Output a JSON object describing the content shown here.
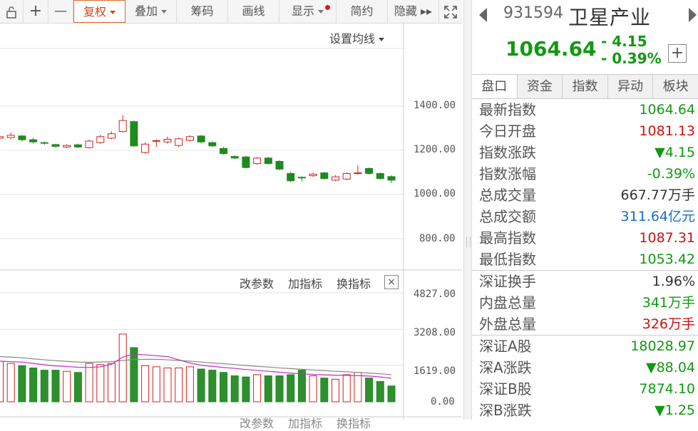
{
  "toolbar": {
    "items": [
      {
        "label": ""
      },
      {
        "label": "+"
      },
      {
        "label": "—"
      },
      {
        "label": "复权"
      },
      {
        "label": "叠加"
      },
      {
        "label": "筹码"
      },
      {
        "label": "画线"
      },
      {
        "label": "显示"
      },
      {
        "label": "简约"
      },
      {
        "label": "隐藏 ▸▸"
      },
      {
        "label": ""
      }
    ]
  },
  "kchart": {
    "ma_label": "设置均线",
    "price_ticks": [
      "1400.00",
      "1200.00",
      "1000.00",
      "800.00"
    ],
    "volume_ticks": [
      "4827.00",
      "3208.00",
      "1619.00",
      "0.00"
    ],
    "indicator_actions": [
      "改参数",
      "加指标",
      "换指标"
    ],
    "bottom_actions": [
      "改参数",
      "加指标",
      "换指标"
    ],
    "close_label": "×"
  },
  "chart_data": {
    "type": "candlestick",
    "price_axis": [
      800,
      1400
    ],
    "volume_axis": [
      0,
      4827
    ],
    "candles": [
      {
        "o": 1255,
        "c": 1262,
        "h": 1270,
        "l": 1245
      },
      {
        "o": 1258,
        "c": 1268,
        "h": 1280,
        "l": 1250
      },
      {
        "o": 1265,
        "c": 1248,
        "h": 1270,
        "l": 1240
      },
      {
        "o": 1248,
        "c": 1238,
        "h": 1258,
        "l": 1230
      },
      {
        "o": 1235,
        "c": 1232,
        "h": 1240,
        "l": 1225
      },
      {
        "o": 1226,
        "c": 1218,
        "h": 1230,
        "l": 1212
      },
      {
        "o": 1215,
        "c": 1222,
        "h": 1228,
        "l": 1210
      },
      {
        "o": 1225,
        "c": 1215,
        "h": 1230,
        "l": 1210
      },
      {
        "o": 1212,
        "c": 1242,
        "h": 1248,
        "l": 1208
      },
      {
        "o": 1235,
        "c": 1262,
        "h": 1270,
        "l": 1230
      },
      {
        "o": 1255,
        "c": 1275,
        "h": 1285,
        "l": 1250
      },
      {
        "o": 1285,
        "c": 1335,
        "h": 1360,
        "l": 1280
      },
      {
        "o": 1330,
        "c": 1220,
        "h": 1335,
        "l": 1215
      },
      {
        "o": 1190,
        "c": 1228,
        "h": 1236,
        "l": 1185
      },
      {
        "o": 1242,
        "c": 1244,
        "h": 1250,
        "l": 1215
      },
      {
        "o": 1238,
        "c": 1250,
        "h": 1262,
        "l": 1230
      },
      {
        "o": 1222,
        "c": 1252,
        "h": 1258,
        "l": 1215
      },
      {
        "o": 1245,
        "c": 1262,
        "h": 1268,
        "l": 1240
      },
      {
        "o": 1265,
        "c": 1238,
        "h": 1270,
        "l": 1232
      },
      {
        "o": 1235,
        "c": 1220,
        "h": 1240,
        "l": 1215
      },
      {
        "o": 1208,
        "c": 1185,
        "h": 1215,
        "l": 1180
      },
      {
        "o": 1172,
        "c": 1165,
        "h": 1178,
        "l": 1160
      },
      {
        "o": 1170,
        "c": 1122,
        "h": 1175,
        "l": 1118
      },
      {
        "o": 1140,
        "c": 1165,
        "h": 1170,
        "l": 1135
      },
      {
        "o": 1165,
        "c": 1140,
        "h": 1170,
        "l": 1135
      },
      {
        "o": 1150,
        "c": 1115,
        "h": 1155,
        "l": 1110
      },
      {
        "o": 1095,
        "c": 1062,
        "h": 1105,
        "l": 1055
      },
      {
        "o": 1078,
        "c": 1075,
        "h": 1082,
        "l": 1058
      },
      {
        "o": 1085,
        "c": 1092,
        "h": 1098,
        "l": 1080
      },
      {
        "o": 1098,
        "c": 1072,
        "h": 1102,
        "l": 1068
      },
      {
        "o": 1065,
        "c": 1080,
        "h": 1088,
        "l": 1060
      },
      {
        "o": 1070,
        "c": 1095,
        "h": 1100,
        "l": 1065
      },
      {
        "o": 1095,
        "c": 1098,
        "h": 1132,
        "l": 1090
      },
      {
        "o": 1118,
        "c": 1095,
        "h": 1122,
        "l": 1090
      },
      {
        "o": 1095,
        "c": 1072,
        "h": 1100,
        "l": 1068
      },
      {
        "o": 1081,
        "c": 1065,
        "h": 1087,
        "l": 1053
      }
    ],
    "volumes": [
      1800,
      1700,
      1600,
      1500,
      1400,
      1400,
      1350,
      1300,
      1700,
      1650,
      1700,
      3000,
      2400,
      1600,
      1550,
      1500,
      1500,
      1550,
      1450,
      1400,
      1300,
      1150,
      1100,
      1200,
      1150,
      1150,
      1200,
      1400,
      1150,
      1050,
      1000,
      1200,
      1300,
      1050,
      900,
      700
    ],
    "ma_volume_purple": [
      1800,
      1780,
      1760,
      1700,
      1640,
      1590,
      1560,
      1530,
      1520,
      1550,
      1660,
      1980,
      2120,
      2080,
      2040,
      2000,
      1860,
      1720,
      1620,
      1570,
      1520,
      1480,
      1430,
      1390,
      1350,
      1310,
      1270,
      1240,
      1210,
      1190,
      1180,
      1170,
      1160,
      1140,
      1100,
      1040
    ],
    "ma_volume_gray": [
      2000,
      1980,
      1950,
      1900,
      1860,
      1820,
      1790,
      1760,
      1750,
      1760,
      1780,
      1830,
      1870,
      1880,
      1880,
      1860,
      1830,
      1800,
      1760,
      1720,
      1690,
      1650,
      1610,
      1570,
      1540,
      1500,
      1470,
      1440,
      1410,
      1380,
      1350,
      1330,
      1300,
      1270,
      1240,
      1200
    ]
  },
  "quote": {
    "code": "931594",
    "name": "卫星产业",
    "price": "1064.64",
    "change": "- 4.15",
    "change_pct": "- 0.39%",
    "plus_label": "+"
  },
  "tabs": [
    "盘口",
    "资金",
    "指数",
    "异动",
    "板块"
  ],
  "rows_group1": [
    {
      "label": "最新指数",
      "value": "1064.64",
      "color": "#119911"
    },
    {
      "label": "今日开盘",
      "value": "1081.13",
      "color": "#cc1111"
    },
    {
      "label": "指数涨跌",
      "value": "▼4.15",
      "color": "#119911"
    },
    {
      "label": "指数涨幅",
      "value": "-0.39%",
      "color": "#119911"
    },
    {
      "label": "总成交量",
      "value": "667.77万手",
      "color": "#333333"
    },
    {
      "label": "总成交额",
      "value": "311.64亿元",
      "color": "#1a6ec8"
    },
    {
      "label": "最高指数",
      "value": "1087.31",
      "color": "#cc1111"
    },
    {
      "label": "最低指数",
      "value": "1053.42",
      "color": "#119911"
    }
  ],
  "rows_group2": [
    {
      "label": "深证换手",
      "value": "1.96%",
      "color": "#333333"
    },
    {
      "label": "内盘总量",
      "value": "341万手",
      "color": "#119911"
    },
    {
      "label": "外盘总量",
      "value": "326万手",
      "color": "#cc1111"
    }
  ],
  "rows_group3": [
    {
      "label": "深证A股",
      "value": "18028.97",
      "color": "#119911"
    },
    {
      "label": "深A涨跌",
      "value": "▼88.04",
      "color": "#119911"
    },
    {
      "label": "深证B股",
      "value": "7874.10",
      "color": "#119911"
    },
    {
      "label": "深B涨跌",
      "value": "▼1.25",
      "color": "#119911"
    }
  ]
}
